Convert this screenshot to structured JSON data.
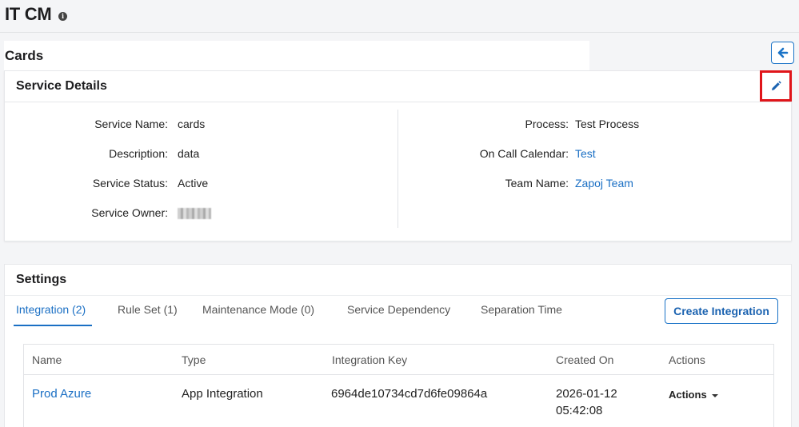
{
  "page": {
    "title": "IT CM"
  },
  "breadcrumb": {
    "current": "Cards"
  },
  "service_details": {
    "title": "Service Details",
    "left": [
      {
        "label": "Service Name:",
        "value": "cards"
      },
      {
        "label": "Description:",
        "value": "data"
      },
      {
        "label": "Service Status:",
        "value": "Active"
      },
      {
        "label": "Service Owner:",
        "value": ""
      }
    ],
    "right": [
      {
        "label": "Process:",
        "value": "Test Process"
      },
      {
        "label": "On Call Calendar:",
        "value": "Test"
      },
      {
        "label": "Team Name:",
        "value": "Zapoj Team"
      }
    ]
  },
  "settings": {
    "title": "Settings",
    "tabs": [
      "Integration (2)",
      "Rule Set (1)",
      "Maintenance Mode (0)",
      "Service Dependency",
      "Separation Time"
    ],
    "create_label": "Create Integration",
    "table": {
      "headers": [
        "Name",
        "Type",
        "Integration Key",
        "Created On",
        "Actions"
      ],
      "rows": [
        {
          "name": "Prod Azure",
          "type": "App Integration",
          "key": "6964de10734cd7d6fe09864a",
          "created_date": "2026-01-12",
          "created_time": "05:42:08",
          "actions": "Actions"
        }
      ]
    }
  },
  "colors": {
    "accent": "#1a6fc4",
    "highlight": "#e0151a"
  },
  "icons": {
    "info": "info-icon",
    "back": "arrow-left-icon",
    "edit": "pencil-icon",
    "dropdown": "caret-down-icon"
  }
}
